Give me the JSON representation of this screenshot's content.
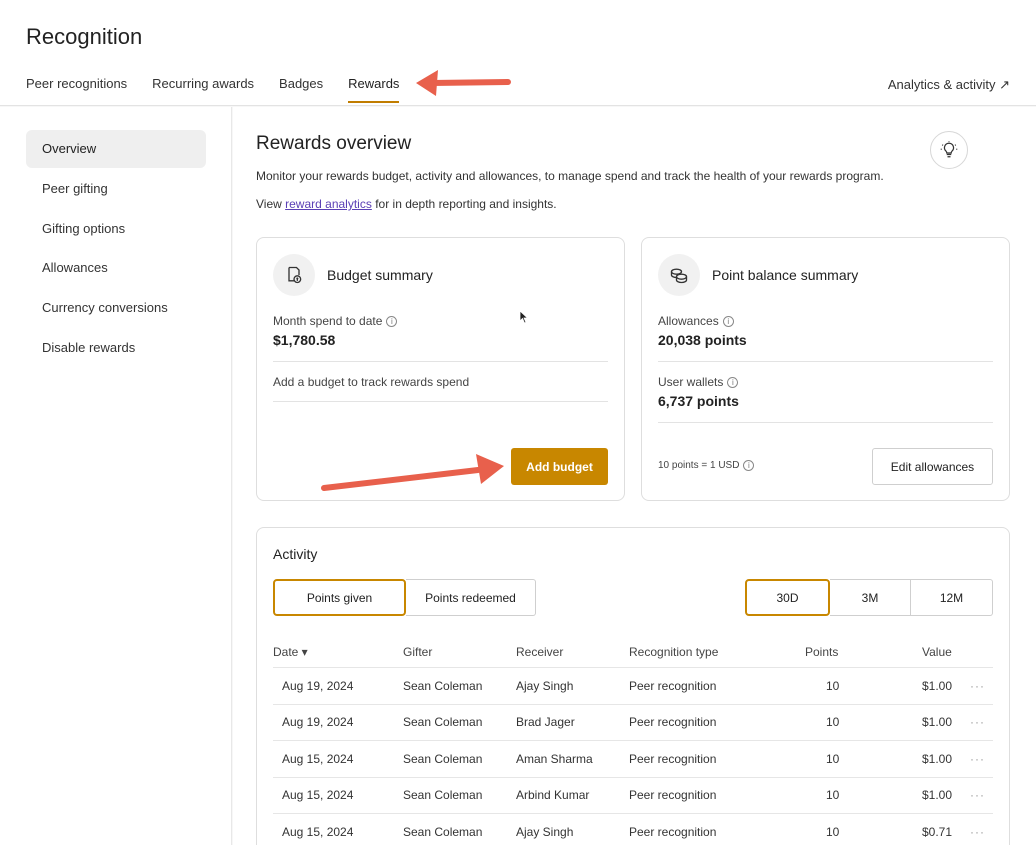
{
  "app": {
    "title": "Recognition"
  },
  "tabs": [
    "Peer recognitions",
    "Recurring awards",
    "Badges",
    "Rewards"
  ],
  "analytics_link": "Analytics & activity ↗",
  "sidebar": [
    "Overview",
    "Peer gifting",
    "Gifting options",
    "Allowances",
    "Currency conversions",
    "Disable rewards"
  ],
  "page": {
    "title": "Rewards overview",
    "description": "Monitor your rewards budget, activity and allowances, to manage spend and track the health of your rewards program.",
    "view_prefix": "View",
    "view_link": "reward analytics",
    "view_suffix": "for in depth reporting and insights."
  },
  "budget": {
    "title": "Budget summary",
    "spend_label": "Month spend to date",
    "spend_value": "$1,780.58",
    "note": "Add a budget to track rewards spend",
    "button": "Add budget"
  },
  "points": {
    "title": "Point balance summary",
    "allowances_label": "Allowances",
    "allowances_value": "20,038 points",
    "wallets_label": "User wallets",
    "wallets_value": "6,737 points",
    "rate": "10 points = 1 USD",
    "button": "Edit allowances"
  },
  "activity": {
    "title": "Activity",
    "type_tabs": [
      "Points given",
      "Points redeemed"
    ],
    "range_tabs": [
      "30D",
      "3M",
      "12M"
    ],
    "columns": [
      "Date ▾",
      "Gifter",
      "Receiver",
      "Recognition type",
      "Points",
      "Value"
    ],
    "rows": [
      [
        "Aug 19, 2024",
        "Sean Coleman",
        "Ajay Singh",
        "Peer recognition",
        "10",
        "$1.00"
      ],
      [
        "Aug 19, 2024",
        "Sean Coleman",
        "Brad Jager",
        "Peer recognition",
        "10",
        "$1.00"
      ],
      [
        "Aug 15, 2024",
        "Sean Coleman",
        "Aman Sharma",
        "Peer recognition",
        "10",
        "$1.00"
      ],
      [
        "Aug 15, 2024",
        "Sean Coleman",
        "Arbind Kumar",
        "Peer recognition",
        "10",
        "$1.00"
      ],
      [
        "Aug 15, 2024",
        "Sean Coleman",
        "Ajay Singh",
        "Peer recognition",
        "10",
        "$0.71"
      ]
    ],
    "more": "···"
  },
  "colors": {
    "accent": "#c88700",
    "arrow": "#e8604c",
    "link": "#5a3fb5"
  }
}
